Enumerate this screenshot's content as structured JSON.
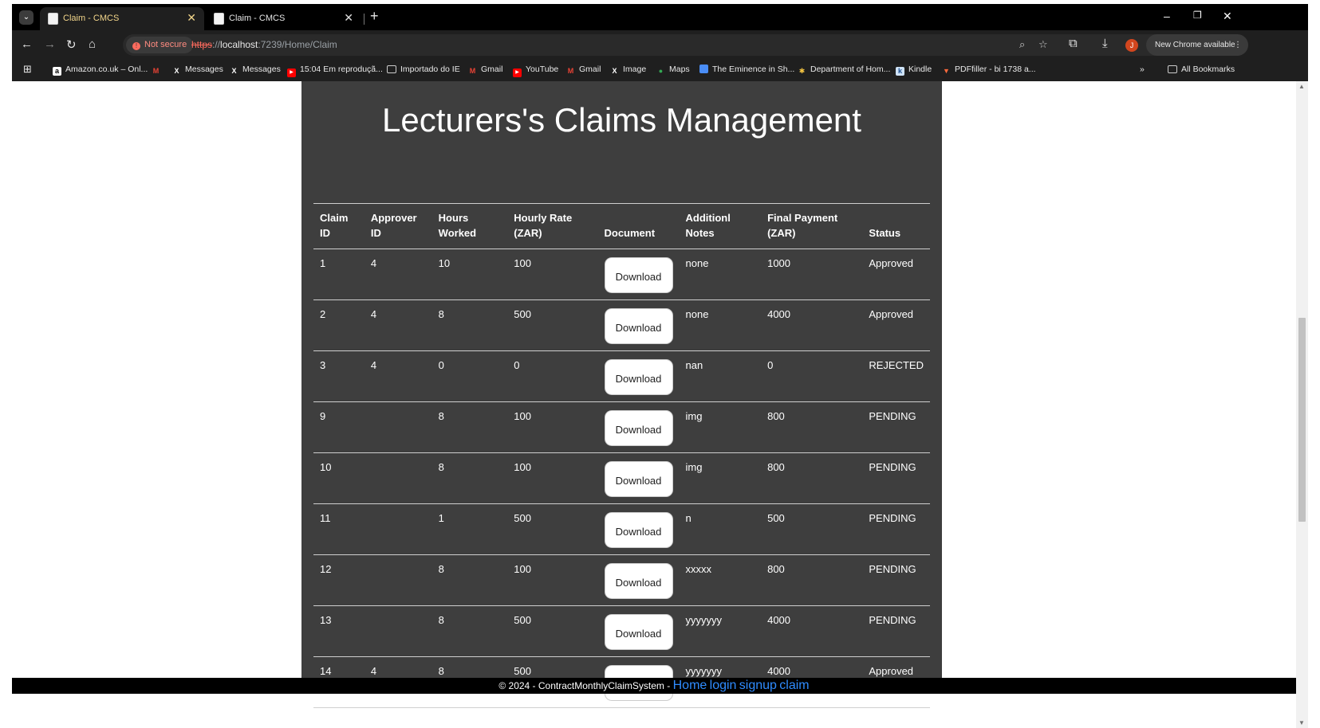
{
  "browser": {
    "tabs": [
      {
        "title": "Claim - CMCS",
        "active": true
      },
      {
        "title": "Claim - CMCS",
        "active": false
      }
    ],
    "not_secure_label": "Not secure",
    "url_scheme": "https",
    "url_sep": "://",
    "url_host": "localhost",
    "url_rest": ":7239/Home/Claim",
    "profile_initial": "J",
    "update_label": "New Chrome available"
  },
  "bookmarks": {
    "items": [
      {
        "label": "Amazon.co.uk – Onl...",
        "icon": "amazon-icon"
      },
      {
        "label": "",
        "icon": "gmail-icon"
      },
      {
        "label": "Messages",
        "icon": "x-icon"
      },
      {
        "label": "Messages",
        "icon": "x-icon"
      },
      {
        "label": "15:04 Em reproduçã...",
        "icon": "youtube-icon"
      },
      {
        "label": "Importado do IE",
        "icon": "folder-icon"
      },
      {
        "label": "Gmail",
        "icon": "gmail-icon"
      },
      {
        "label": "YouTube",
        "icon": "youtube-icon"
      },
      {
        "label": "Gmail",
        "icon": "gmail-icon"
      },
      {
        "label": "Image",
        "icon": "x-icon"
      },
      {
        "label": "Maps",
        "icon": "maps-icon"
      },
      {
        "label": "The Eminence in Sh...",
        "icon": "document-icon"
      },
      {
        "label": "Department of Hom...",
        "icon": "crest-icon"
      },
      {
        "label": "Kindle",
        "icon": "kindle-icon"
      },
      {
        "label": "PDFfiller - bi 1738 a...",
        "icon": "pdffiller-icon"
      }
    ],
    "all_bookmarks": "All Bookmarks"
  },
  "page": {
    "title": "Lecturers's Claims Management",
    "table": {
      "headers": [
        "Claim ID",
        "Approver ID",
        "Hours Worked",
        "Hourly Rate (ZAR)",
        "Document",
        "Additionl Notes",
        "Final Payment (ZAR)",
        "Status"
      ],
      "download_label": "Download",
      "rows": [
        {
          "claim_id": "1",
          "approver_id": "4",
          "hours": "10",
          "rate": "100",
          "notes": "none",
          "payment": "1000",
          "status": "Approved"
        },
        {
          "claim_id": "2",
          "approver_id": "4",
          "hours": "8",
          "rate": "500",
          "notes": "none",
          "payment": "4000",
          "status": "Approved"
        },
        {
          "claim_id": "3",
          "approver_id": "4",
          "hours": "0",
          "rate": "0",
          "notes": "nan",
          "payment": "0",
          "status": "REJECTED"
        },
        {
          "claim_id": "9",
          "approver_id": "",
          "hours": "8",
          "rate": "100",
          "notes": "img",
          "payment": "800",
          "status": "PENDING"
        },
        {
          "claim_id": "10",
          "approver_id": "",
          "hours": "8",
          "rate": "100",
          "notes": "img",
          "payment": "800",
          "status": "PENDING"
        },
        {
          "claim_id": "11",
          "approver_id": "",
          "hours": "1",
          "rate": "500",
          "notes": "n",
          "payment": "500",
          "status": "PENDING"
        },
        {
          "claim_id": "12",
          "approver_id": "",
          "hours": "8",
          "rate": "100",
          "notes": "xxxxx",
          "payment": "800",
          "status": "PENDING"
        },
        {
          "claim_id": "13",
          "approver_id": "",
          "hours": "8",
          "rate": "500",
          "notes": "yyyyyyy",
          "payment": "4000",
          "status": "PENDING"
        },
        {
          "claim_id": "14",
          "approver_id": "4",
          "hours": "8",
          "rate": "500",
          "notes": "yyyyyyy",
          "payment": "4000",
          "status": "Approved"
        }
      ]
    }
  },
  "footer": {
    "copyright": "© 2024 - ContractMonthlyClaimSystem -",
    "links": [
      "Home",
      "login",
      "signup",
      "claim"
    ]
  }
}
